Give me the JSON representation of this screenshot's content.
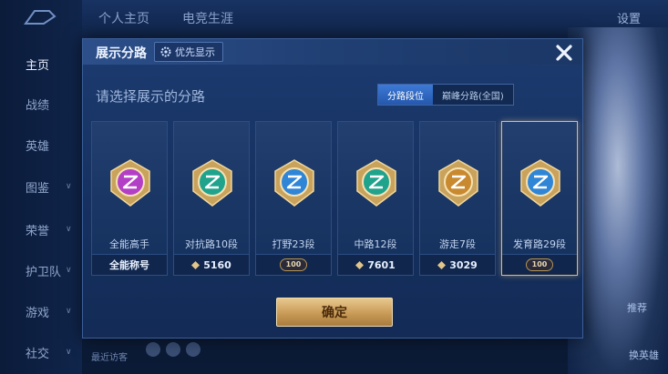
{
  "background": {
    "nav": [
      {
        "label": "主页",
        "active": true
      },
      {
        "label": "战绩"
      },
      {
        "label": "英雄"
      },
      {
        "label": "图鉴",
        "chevron": true
      },
      {
        "label": "荣誉",
        "chevron": true
      },
      {
        "label": "护卫队",
        "chevron": true
      },
      {
        "label": "游戏",
        "chevron": true
      },
      {
        "label": "社交",
        "chevron": true
      }
    ],
    "top_tabs": [
      "个人主页",
      "电竞生涯"
    ],
    "settings_label": "设置",
    "right_labels": [
      "推荐",
      "换英雄"
    ],
    "bottom_text": "最近访客"
  },
  "modal": {
    "title": "展示分路",
    "priority_label": "优先显示",
    "close_icon": "close-icon",
    "subtitle": "请选择展示的分路",
    "segments": {
      "active": "分路段位",
      "inactive": "巅峰分路(全国)"
    },
    "cards": [
      {
        "name": "全能高手",
        "footer": "全能称号",
        "footer_type": "text",
        "emblem_color": "#b43fc7",
        "selected": false
      },
      {
        "name": "对抗路10段",
        "footer": "5160",
        "footer_type": "points",
        "emblem_color": "#1fa38c",
        "selected": false
      },
      {
        "name": "打野23段",
        "footer": "100",
        "footer_type": "badge",
        "emblem_color": "#2f86d6",
        "selected": false
      },
      {
        "name": "中路12段",
        "footer": "7601",
        "footer_type": "points",
        "emblem_color": "#1fa38c",
        "selected": false
      },
      {
        "name": "游走7段",
        "footer": "3029",
        "footer_type": "points",
        "emblem_color": "#c8892f",
        "selected": false
      },
      {
        "name": "发育路29段",
        "footer": "100",
        "footer_type": "badge",
        "emblem_color": "#2f86d6",
        "selected": true
      }
    ],
    "confirm_label": "确定"
  },
  "colors": {
    "accent_gold": "#e2b97a",
    "modal_bg": "#1d3b70",
    "active_tab": "#2f6ac6"
  }
}
